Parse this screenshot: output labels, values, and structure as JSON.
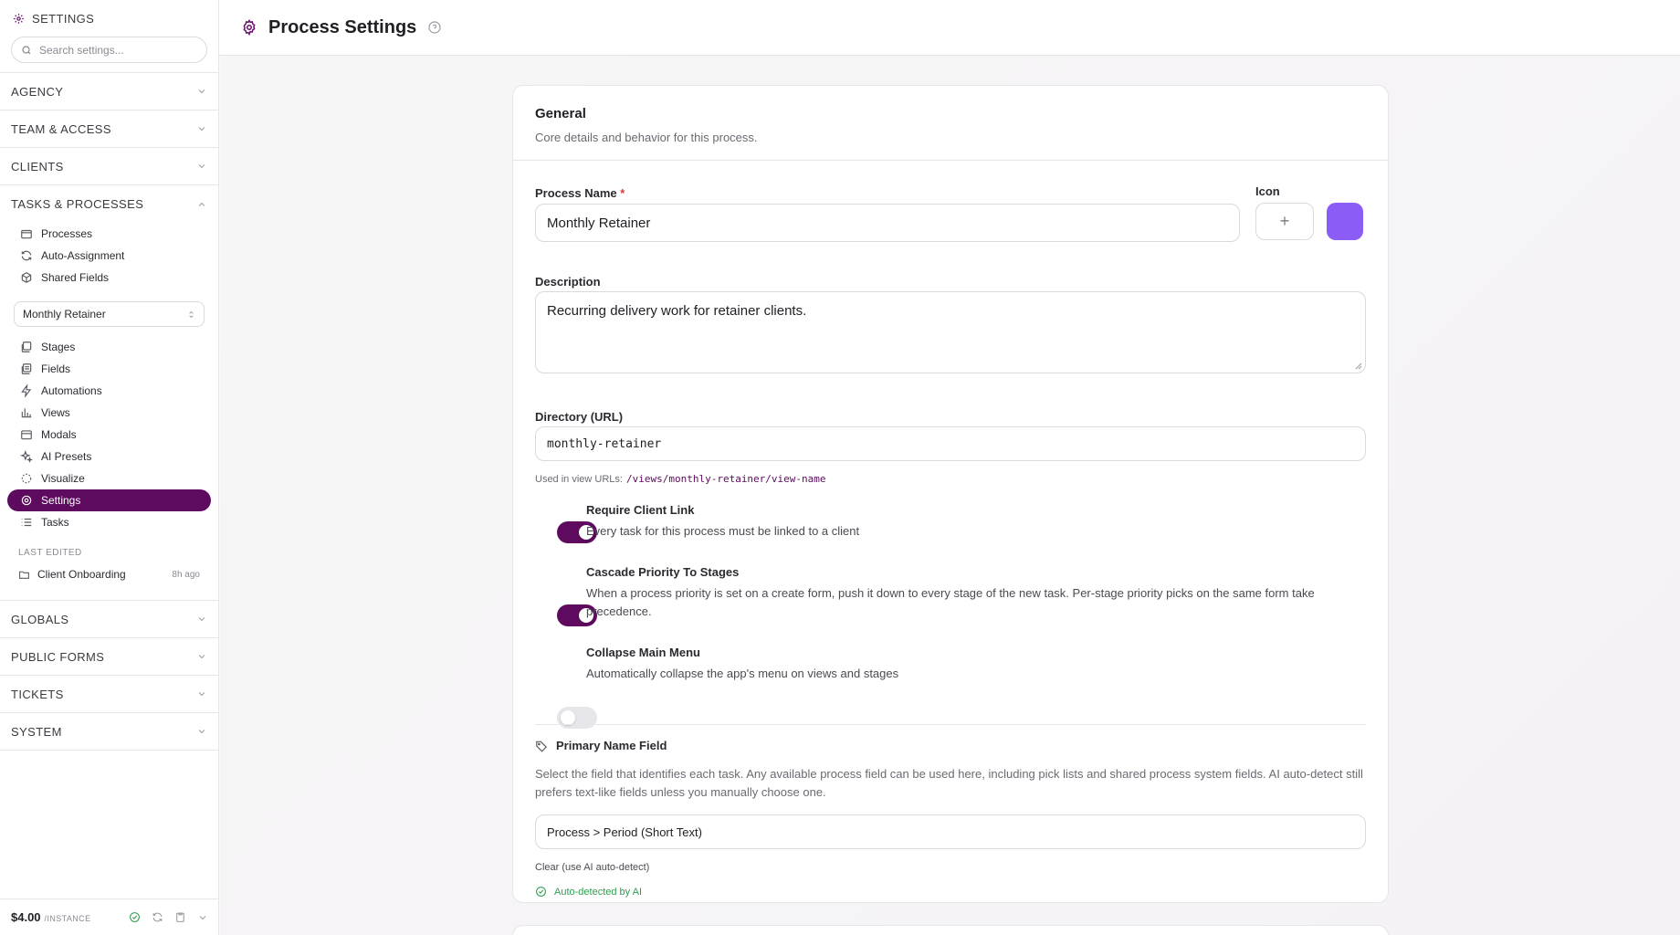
{
  "sidebar": {
    "title": "SETTINGS",
    "search_placeholder": "Search settings...",
    "sections_top": [
      "AGENCY",
      "TEAM & ACCESS",
      "CLIENTS"
    ],
    "open_section": "TASKS & PROCESSES",
    "process_items": [
      "Processes",
      "Auto-Assignment",
      "Shared Fields"
    ],
    "selected_process": "Monthly Retainer",
    "process_nav": [
      "Stages",
      "Fields",
      "Automations",
      "Views",
      "Modals",
      "AI Presets",
      "Visualize",
      "Settings",
      "Tasks"
    ],
    "last_edited_label": "LAST EDITED",
    "last_edited_name": "Client Onboarding",
    "last_edited_time": "8h ago",
    "sections_bottom": [
      "GLOBALS",
      "PUBLIC FORMS",
      "TICKETS",
      "SYSTEM"
    ],
    "price": "$4.00",
    "price_unit": "/INSTANCE"
  },
  "header": {
    "title": "Process Settings"
  },
  "general": {
    "title": "General",
    "subtitle": "Core details and behavior for this process.",
    "name_label": "Process Name",
    "required_mark": "*",
    "name_value": "Monthly Retainer",
    "icon_label": "Icon",
    "icon_plus": "+",
    "icon_color": "#8b5cf6",
    "description_label": "Description",
    "description_value": "Recurring delivery work for retainer clients.",
    "directory_label": "Directory (URL)",
    "directory_value": "monthly-retainer",
    "directory_hint": "Used in view URLs:",
    "directory_path": "/views/monthly-retainer/view-name",
    "toggles": [
      {
        "title": "Require Client Link",
        "desc": "Every task for this process must be linked to a client",
        "on": true
      },
      {
        "title": "Cascade Priority To Stages",
        "desc": "When a process priority is set on a create form, push it down to every stage of the new task. Per-stage priority picks on the same form take precedence.",
        "on": true
      },
      {
        "title": "Collapse Main Menu",
        "desc": "Automatically collapse the app's menu on views and stages",
        "on": false
      }
    ],
    "primary_title": "Primary Name Field",
    "primary_desc": "Select the field that identifies each task. Any available process field can be used here, including pick lists and shared process system fields. AI auto-detect still prefers text-like fields unless you manually choose one.",
    "primary_value": "Process > Period (Short Text)",
    "clear_label": "Clear (use AI auto-detect)",
    "auto_label": "Auto-detected by AI"
  },
  "colors": {
    "accent": "#5e0a5e",
    "success": "#2e9e4f"
  }
}
